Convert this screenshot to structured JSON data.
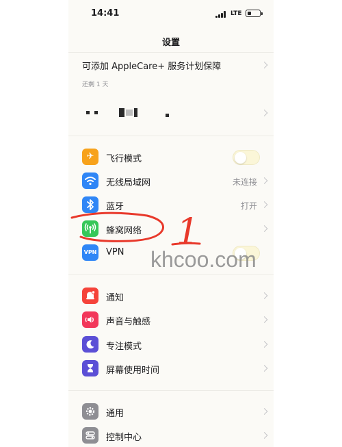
{
  "status_bar": {
    "time": "14:41",
    "network": "LTE"
  },
  "nav": {
    "title": "设置"
  },
  "applecare": {
    "title": "可添加 AppleCare+ 服务计划保障",
    "subtitle": "还剩 1 天"
  },
  "groups": [
    {
      "rows": [
        {
          "label": "飞行模式",
          "icon": "airplane-icon",
          "color": "#f7a21b",
          "accessory": "toggle"
        },
        {
          "label": "无线局域网",
          "icon": "wifi-icon",
          "color": "#2f86f6",
          "value": "未连接",
          "accessory": "chevron"
        },
        {
          "label": "蓝牙",
          "icon": "bluetooth-icon",
          "color": "#2f86f6",
          "value": "打开",
          "accessory": "chevron"
        },
        {
          "label": "蜂窝网络",
          "icon": "cellular-icon",
          "color": "#36c759",
          "accessory": "chevron"
        },
        {
          "label": "VPN",
          "icon": "vpn-icon",
          "icon_text": "VPN",
          "color": "#2f86f6",
          "accessory": "toggle"
        }
      ]
    },
    {
      "rows": [
        {
          "label": "通知",
          "icon": "notifications-icon",
          "color": "#f5433a",
          "accessory": "chevron"
        },
        {
          "label": "声音与触感",
          "icon": "speaker-icon",
          "color": "#f2375a",
          "accessory": "chevron"
        },
        {
          "label": "专注模式",
          "icon": "moon-icon",
          "color": "#5b4fd6",
          "accessory": "chevron"
        },
        {
          "label": "屏幕使用时间",
          "icon": "hourglass-icon",
          "color": "#5b4fd6",
          "accessory": "chevron"
        }
      ]
    },
    {
      "rows": [
        {
          "label": "通用",
          "icon": "gear-icon",
          "color": "#8e8e93",
          "accessory": "chevron"
        },
        {
          "label": "控制中心",
          "icon": "control-center-icon",
          "color": "#8e8e93",
          "accessory": "chevron"
        }
      ]
    }
  ],
  "annotation": {
    "text": "1",
    "color": "#e8392b"
  },
  "watermark": {
    "text": "khcoo.com"
  }
}
